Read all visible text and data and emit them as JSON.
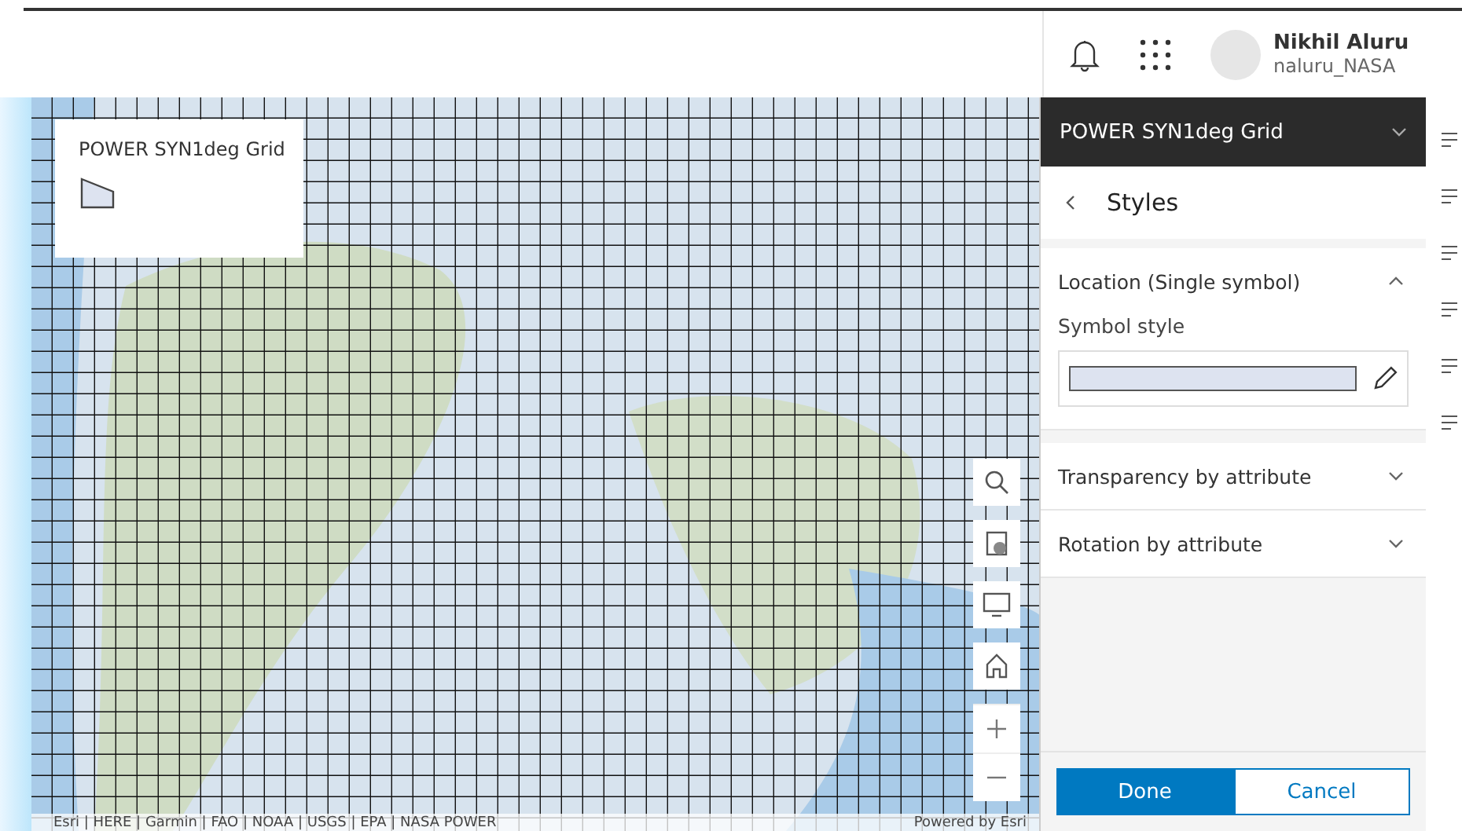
{
  "header": {
    "user_name": "Nikhil Aluru",
    "username": "naluru_NASA"
  },
  "legend": {
    "title": "POWER SYN1deg Grid"
  },
  "map": {
    "attribution": "Esri | HERE | Garmin | FAO | NOAA | USGS | EPA | NASA POWER",
    "powered_by": "Powered by Esri"
  },
  "panel": {
    "layer_title": "POWER SYN1deg Grid",
    "heading": "Styles",
    "sections": [
      {
        "title": "Location (Single symbol)",
        "expanded": true,
        "field_label": "Symbol style"
      },
      {
        "title": "Transparency by attribute",
        "expanded": false
      },
      {
        "title": "Rotation by attribute",
        "expanded": false
      }
    ],
    "buttons": [
      {
        "label": "Done",
        "kind": "primary"
      },
      {
        "label": "Cancel",
        "kind": "secondary"
      }
    ]
  }
}
